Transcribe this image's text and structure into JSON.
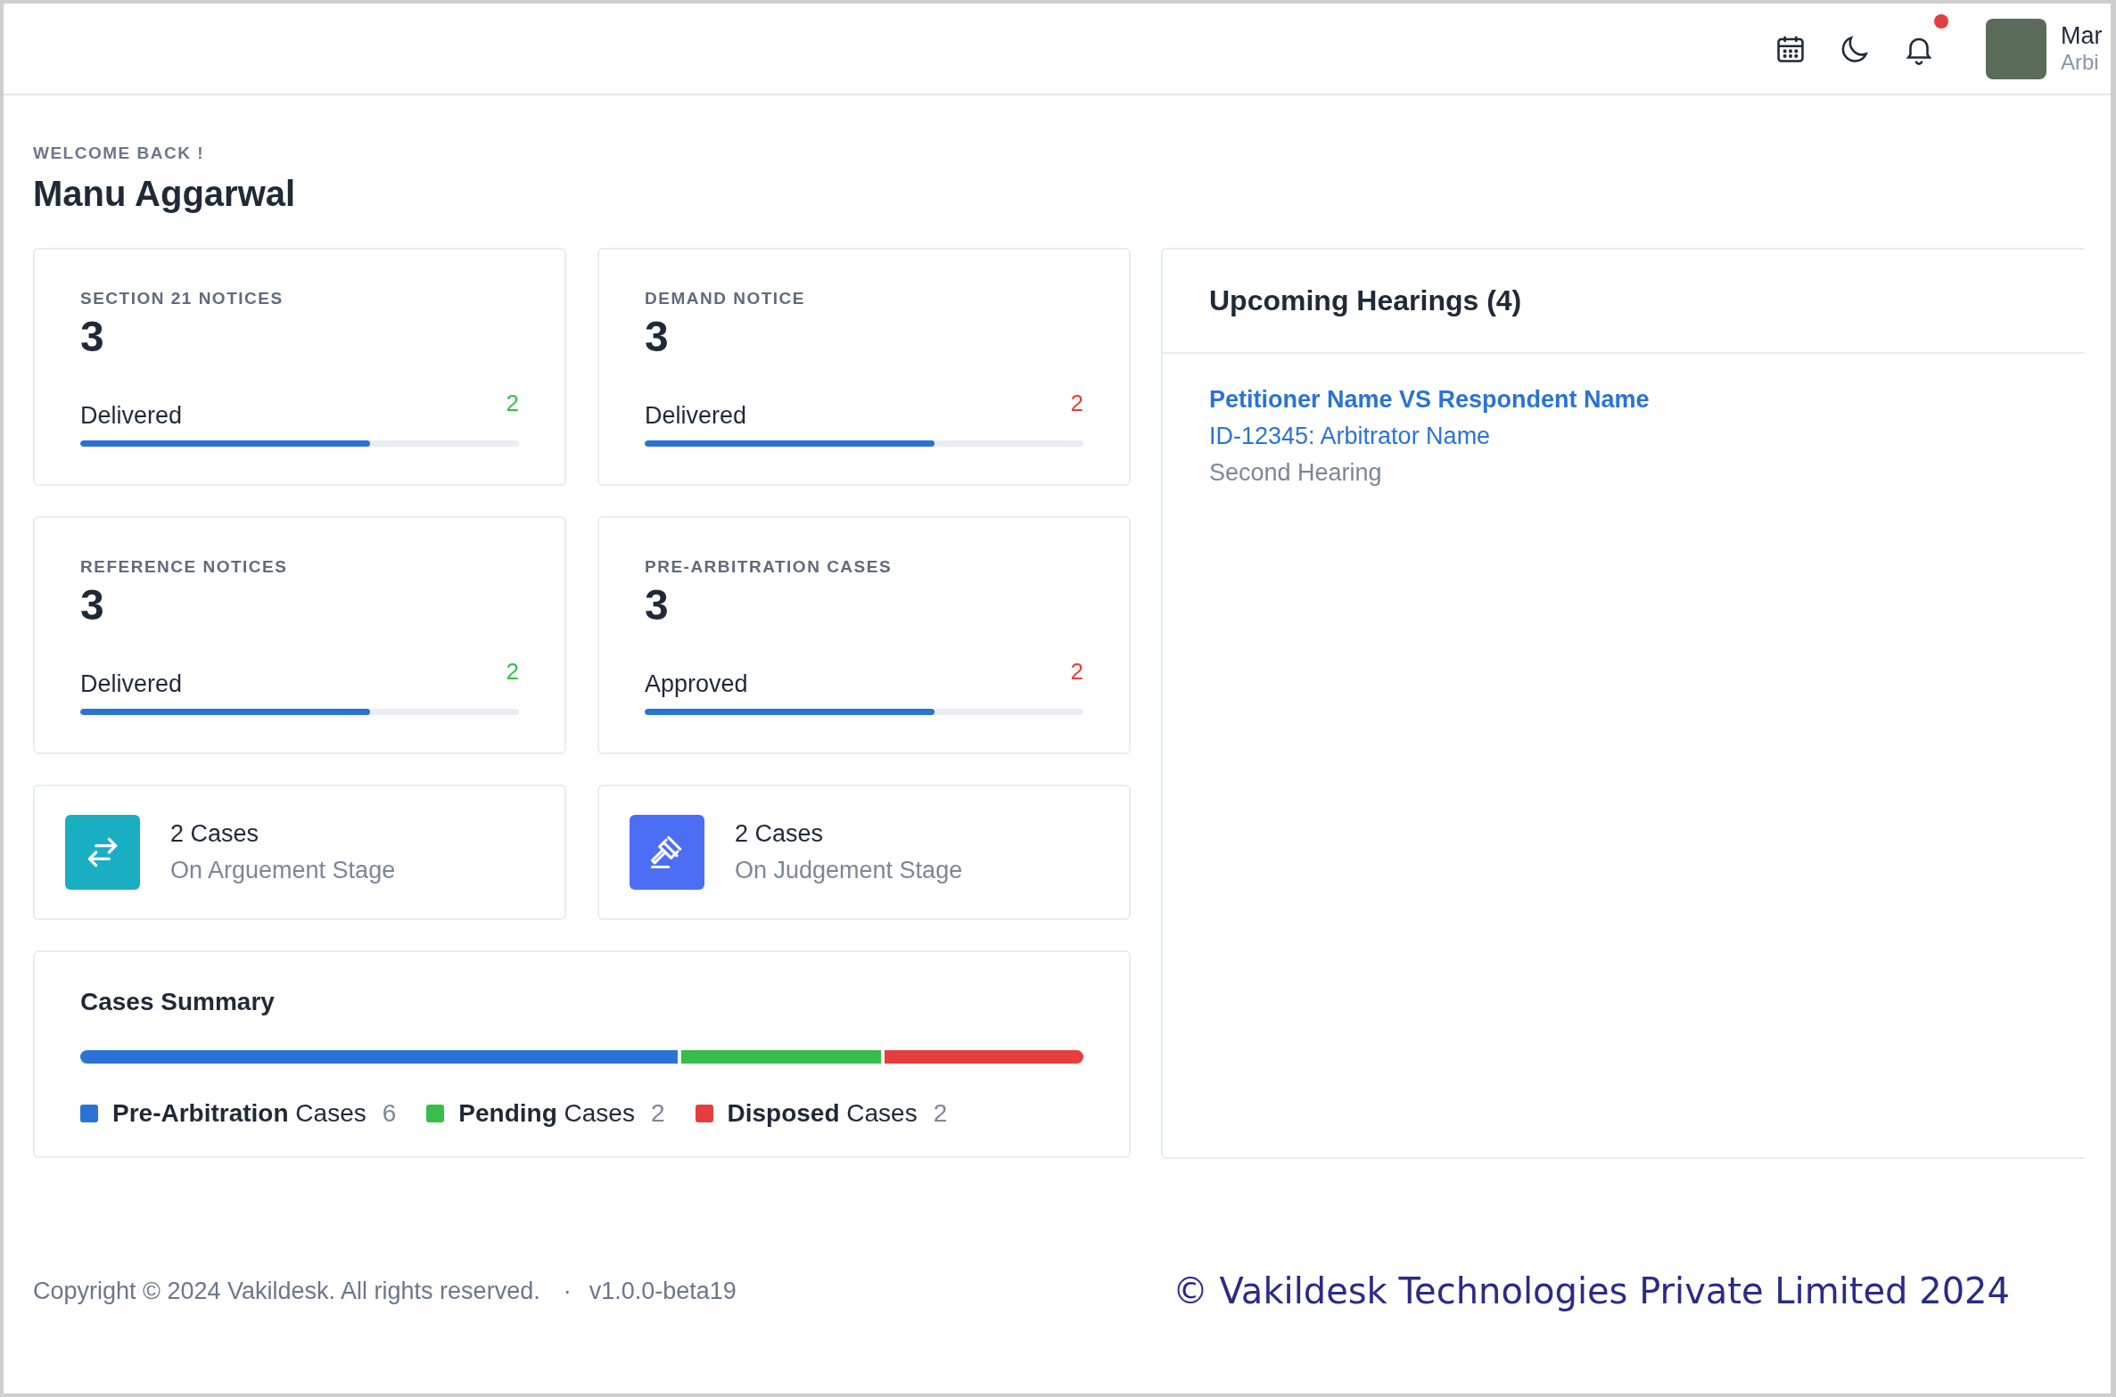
{
  "header": {
    "notification_dot": true,
    "user": {
      "name": "Mar",
      "role": "Arbi"
    }
  },
  "welcome": {
    "label": "WELCOME BACK !",
    "name": "Manu Aggarwal"
  },
  "stat_cards": [
    {
      "title": "SECTION 21 NOTICES",
      "value": "3",
      "status": "Delivered",
      "count": "2",
      "color": "#34c04a",
      "level": 0.66
    },
    {
      "title": "DEMAND NOTICE",
      "value": "3",
      "status": "Delivered",
      "count": "2",
      "color": "#e53e3e",
      "level": 0.66
    },
    {
      "title": "REFERENCE NOTICES",
      "value": "3",
      "status": "Delivered",
      "count": "2",
      "color": "#34c04a",
      "level": 0.66
    },
    {
      "title": "PRE-ARBITRATION CASES",
      "value": "3",
      "status": "Approved",
      "count": "2",
      "color": "#e53e3e",
      "level": 0.66
    }
  ],
  "stage_cards": [
    {
      "kind": "arguement",
      "count": "2 Cases",
      "label": "On Arguement Stage",
      "color": "#1aaec3"
    },
    {
      "kind": "judgement",
      "count": "2 Cases",
      "label": "On Judgement Stage",
      "color": "#4b6ef5"
    }
  ],
  "cases_summary": {
    "title": "Cases Summary",
    "segments": [
      {
        "name": "**Pre-Arbitration** Cases",
        "count": "6",
        "color": "#2a73d4"
      },
      {
        "name": "**Pending** Cases",
        "count": "2",
        "color": "#36bd4a"
      },
      {
        "name": "**Disposed** Cases",
        "count": "2",
        "color": "#e53e3e"
      }
    ]
  },
  "upcoming_hearings": {
    "title": "Upcoming Hearings (4)",
    "items": [
      {
        "parties": "Petitioner Name VS Respondent Name",
        "case": "ID-12345: Arbitrator Name",
        "stage": "Second Hearing"
      }
    ]
  },
  "footer": {
    "copyright": "Copyright © 2024 Vakildesk. All rights reserved.",
    "separator": "·",
    "version": "v1.0.0-beta19"
  },
  "caption": "© Vakildesk Technologies Private Limited 2024"
}
